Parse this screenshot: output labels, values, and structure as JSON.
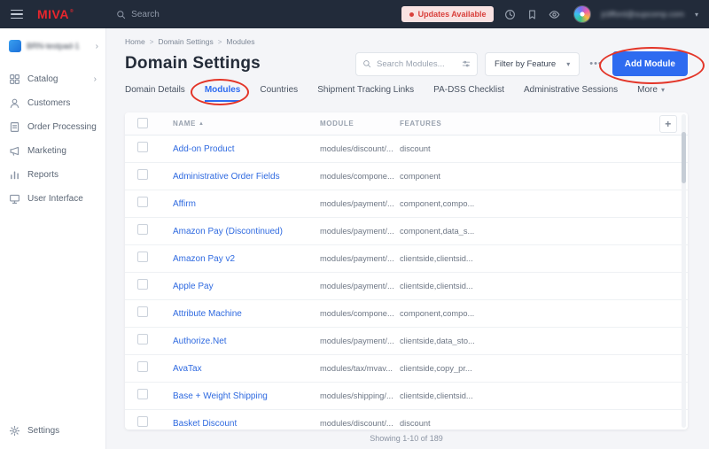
{
  "colors": {
    "accent_blue": "#2e6bf0",
    "topbar_bg": "#222b3a",
    "logo_red": "#e8262d",
    "annotation_red": "#e33528"
  },
  "icons": {
    "sort_asc": "▲",
    "chevron_down": "▾",
    "chevron_right": "›",
    "breadcrumb_sep": ">",
    "dots": "•••",
    "plus": "+"
  },
  "topbar": {
    "logo": "MIVA",
    "logo_reg": "®",
    "search_placeholder": "Search",
    "updates_label": "Updates Available",
    "user_email": "jclifford@supcomp.com"
  },
  "sidebar": {
    "store_label": "BRN-testpad-1",
    "items": [
      {
        "label": "Catalog",
        "has_chevron": true
      },
      {
        "label": "Customers",
        "has_chevron": false
      },
      {
        "label": "Order Processing",
        "has_chevron": false
      },
      {
        "label": "Marketing",
        "has_chevron": false
      },
      {
        "label": "Reports",
        "has_chevron": false
      },
      {
        "label": "User Interface",
        "has_chevron": false
      }
    ],
    "settings_label": "Settings"
  },
  "main": {
    "breadcrumb": [
      "Home",
      "Domain Settings",
      "Modules"
    ],
    "title": "Domain Settings",
    "toolbar": {
      "search_placeholder": "Search Modules...",
      "filter_label": "Filter by Feature",
      "add_label": "Add Module"
    },
    "tabs": [
      {
        "label": "Domain Details",
        "active": false
      },
      {
        "label": "Modules",
        "active": true
      },
      {
        "label": "Countries",
        "active": false
      },
      {
        "label": "Shipment Tracking Links",
        "active": false
      },
      {
        "label": "PA-DSS Checklist",
        "active": false
      },
      {
        "label": "Administrative Sessions",
        "active": false
      },
      {
        "label": "More",
        "active": false
      }
    ],
    "table": {
      "columns": [
        "NAME",
        "MODULE",
        "FEATURES"
      ],
      "rows": [
        {
          "name": "Add-on Product",
          "module": "modules/discount/...",
          "features": "discount"
        },
        {
          "name": "Administrative Order Fields",
          "module": "modules/compone...",
          "features": "component"
        },
        {
          "name": "Affirm",
          "module": "modules/payment/...",
          "features": "component,compo..."
        },
        {
          "name": "Amazon Pay (Discontinued)",
          "module": "modules/payment/...",
          "features": "component,data_s..."
        },
        {
          "name": "Amazon Pay v2",
          "module": "modules/payment/...",
          "features": "clientside,clientsid..."
        },
        {
          "name": "Apple Pay",
          "module": "modules/payment/...",
          "features": "clientside,clientsid..."
        },
        {
          "name": "Attribute Machine",
          "module": "modules/compone...",
          "features": "component,compo..."
        },
        {
          "name": "Authorize.Net",
          "module": "modules/payment/...",
          "features": "clientside,data_sto..."
        },
        {
          "name": "AvaTax",
          "module": "modules/tax/mvav...",
          "features": "clientside,copy_pr..."
        },
        {
          "name": "Base + Weight Shipping",
          "module": "modules/shipping/...",
          "features": "clientside,clientsid..."
        },
        {
          "name": "Basket Discount",
          "module": "modules/discount/...",
          "features": "discount"
        }
      ],
      "footer": "Showing 1-10 of 189"
    }
  }
}
